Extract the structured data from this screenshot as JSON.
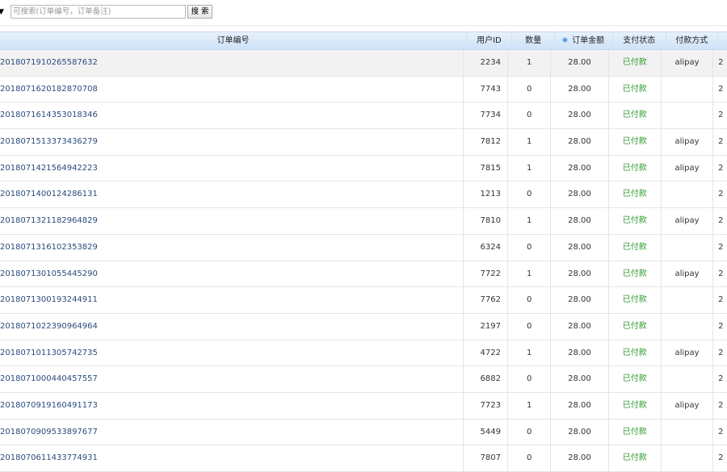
{
  "toolbar": {
    "select_glyph": "▼",
    "search_placeholder": "可搜索(订单编号，订单备注)",
    "search_button": "搜 索"
  },
  "columns": {
    "order_no": "订单编号",
    "user_id": "用户ID",
    "quantity": "数量",
    "amount": "订单金额",
    "pay_status": "支付状态",
    "pay_method": "付款方式"
  },
  "rows": [
    {
      "order_no": "2018071910265587632",
      "user_id": "2234",
      "quantity": "1",
      "amount": "28.00",
      "pay_status": "已付款",
      "pay_method": "alipay",
      "more": "2"
    },
    {
      "order_no": "2018071620182870708",
      "user_id": "7743",
      "quantity": "0",
      "amount": "28.00",
      "pay_status": "已付款",
      "pay_method": "",
      "more": "2"
    },
    {
      "order_no": "2018071614353018346",
      "user_id": "7734",
      "quantity": "0",
      "amount": "28.00",
      "pay_status": "已付款",
      "pay_method": "",
      "more": "2"
    },
    {
      "order_no": "2018071513373436279",
      "user_id": "7812",
      "quantity": "1",
      "amount": "28.00",
      "pay_status": "已付款",
      "pay_method": "alipay",
      "more": "2"
    },
    {
      "order_no": "2018071421564942223",
      "user_id": "7815",
      "quantity": "1",
      "amount": "28.00",
      "pay_status": "已付款",
      "pay_method": "alipay",
      "more": "2"
    },
    {
      "order_no": "2018071400124286131",
      "user_id": "1213",
      "quantity": "0",
      "amount": "28.00",
      "pay_status": "已付款",
      "pay_method": "",
      "more": "2"
    },
    {
      "order_no": "2018071321182964829",
      "user_id": "7810",
      "quantity": "1",
      "amount": "28.00",
      "pay_status": "已付款",
      "pay_method": "alipay",
      "more": "2"
    },
    {
      "order_no": "2018071316102353829",
      "user_id": "6324",
      "quantity": "0",
      "amount": "28.00",
      "pay_status": "已付款",
      "pay_method": "",
      "more": "2"
    },
    {
      "order_no": "2018071301055445290",
      "user_id": "7722",
      "quantity": "1",
      "amount": "28.00",
      "pay_status": "已付款",
      "pay_method": "alipay",
      "more": "2"
    },
    {
      "order_no": "2018071300193244911",
      "user_id": "7762",
      "quantity": "0",
      "amount": "28.00",
      "pay_status": "已付款",
      "pay_method": "",
      "more": "2"
    },
    {
      "order_no": "2018071022390964964",
      "user_id": "2197",
      "quantity": "0",
      "amount": "28.00",
      "pay_status": "已付款",
      "pay_method": "",
      "more": "2"
    },
    {
      "order_no": "2018071011305742735",
      "user_id": "4722",
      "quantity": "1",
      "amount": "28.00",
      "pay_status": "已付款",
      "pay_method": "alipay",
      "more": "2"
    },
    {
      "order_no": "2018071000440457557",
      "user_id": "6882",
      "quantity": "0",
      "amount": "28.00",
      "pay_status": "已付款",
      "pay_method": "",
      "more": "2"
    },
    {
      "order_no": "2018070919160491173",
      "user_id": "7723",
      "quantity": "1",
      "amount": "28.00",
      "pay_status": "已付款",
      "pay_method": "alipay",
      "more": "2"
    },
    {
      "order_no": "2018070909533897677",
      "user_id": "5449",
      "quantity": "0",
      "amount": "28.00",
      "pay_status": "已付款",
      "pay_method": "",
      "more": "2"
    },
    {
      "order_no": "2018070611433774931",
      "user_id": "7807",
      "quantity": "0",
      "amount": "28.00",
      "pay_status": "已付款",
      "pay_method": "",
      "more": "2"
    }
  ]
}
